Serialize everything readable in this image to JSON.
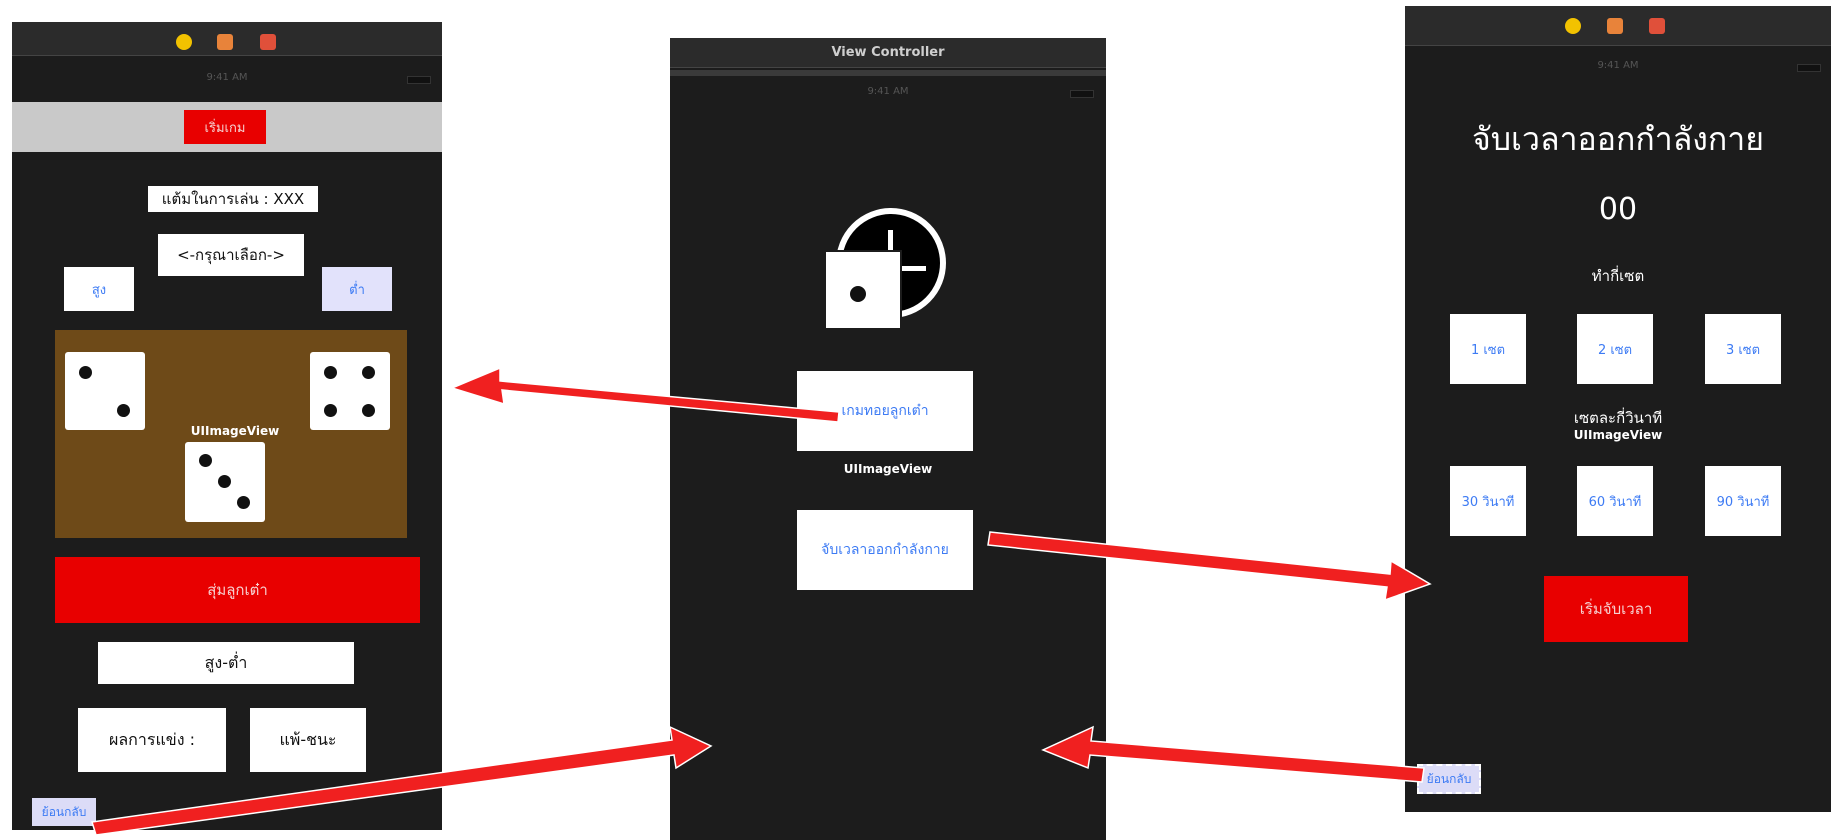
{
  "left": {
    "top_button": "เริ่มเกม",
    "score_label": "แต้มในการเล่น : XXX",
    "picker_label": "<-กรุณาเลือก->",
    "high_button": "สูง",
    "low_button": "ต่ำ",
    "image_view_label": "UIImageView",
    "roll_button": "สุ่มลูกเต๋า",
    "high_low_label": "สูง-ต่ำ",
    "result_label": "ผลการแข่ง :",
    "win_lose_label": "แพ้-ชนะ",
    "back_button": "ย้อนกลับ"
  },
  "center": {
    "title": "View Controller",
    "dice_game_button": "เกมทอยลูกเต๋า",
    "image_view_label": "UIImageView",
    "timer_button": "จับเวลาออกกำลังกาย"
  },
  "right": {
    "title": "จับเวลาออกกำลังกาย",
    "counter": "00",
    "sets_label": "ทำกี่เซต",
    "set_options": [
      "1 เซต",
      "2 เซต",
      "3 เซต"
    ],
    "seconds_label": "เซตละกี่วินาที",
    "image_view_label": "UIImageView",
    "second_options": [
      "30 วินาที",
      "60 วินาที",
      "90 วินาที"
    ],
    "start_button": "เริ่มจับเวลา",
    "back_button": "ย้อนกลับ"
  },
  "colors": {
    "canvas_bg": "#1c1c1c",
    "accent_red": "#e80000",
    "link_blue": "#3d7bf4",
    "dice_panel": "#6e4a18",
    "arrow_red": "#f02020"
  },
  "icons": [
    "app-icon-yellow",
    "cube-icon",
    "exit-icon",
    "clock-icon",
    "dumbbell-icon"
  ]
}
